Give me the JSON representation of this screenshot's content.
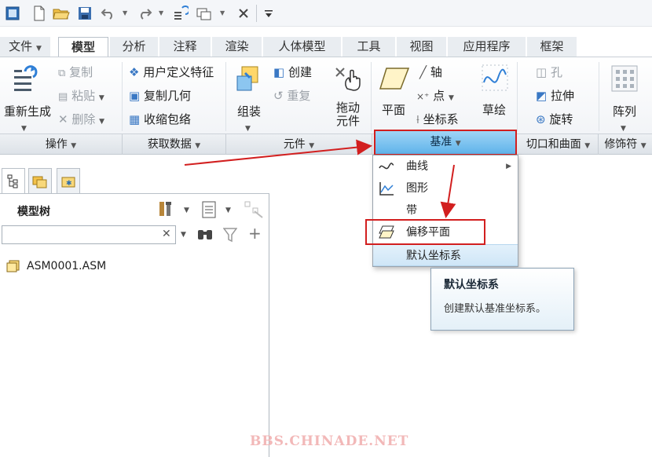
{
  "quick_access": {
    "icons": [
      "window-icon",
      "new-file-icon",
      "open-folder-icon",
      "save-icon",
      "undo-icon",
      "redo-icon",
      "regenerate-icon",
      "windows-icon",
      "close-window-icon",
      "customize-icon"
    ]
  },
  "tabs": [
    {
      "label": "文件",
      "dropdown": true
    },
    {
      "label": "模型",
      "active": true
    },
    {
      "label": "分析"
    },
    {
      "label": "注释"
    },
    {
      "label": "渲染"
    },
    {
      "label": "人体模型"
    },
    {
      "label": "工具"
    },
    {
      "label": "视图"
    },
    {
      "label": "应用程序"
    },
    {
      "label": "框架"
    }
  ],
  "ribbon": {
    "operations": {
      "regenerate": "重新生成",
      "copy": "复制",
      "paste": "粘贴",
      "delete": "删除"
    },
    "get_data": {
      "user_defined_feature": "用户定义特征",
      "copy_geometry": "复制几何",
      "shrinkwrap": "收缩包络"
    },
    "component": {
      "assemble": "组装",
      "create": "创建",
      "repeat": "重复",
      "drag_line1": "拖动",
      "drag_line2": "元件"
    },
    "datum": {
      "plane": "平面",
      "axis": "轴",
      "point": "点",
      "coord_sys": "坐标系",
      "sketch": "草绘"
    },
    "cut_surface": {
      "hole": "孔",
      "extrude": "拉伸",
      "revolve": "旋转"
    },
    "pattern": {
      "pattern": "阵列"
    }
  },
  "groups": [
    {
      "label": "操作"
    },
    {
      "label": "获取数据"
    },
    {
      "label": "元件"
    },
    {
      "label": "基准",
      "active": true
    },
    {
      "label": "切口和曲面"
    },
    {
      "label": "修饰符"
    }
  ],
  "model_tree": {
    "title": "模型树",
    "search_value": "",
    "items": [
      {
        "label": "ASM0001.ASM"
      }
    ]
  },
  "datum_menu": {
    "items": [
      {
        "label": "曲线",
        "icon": "curve-icon",
        "submenu": true
      },
      {
        "label": "图形",
        "icon": "graph-icon"
      },
      {
        "label": "带",
        "icon": ""
      },
      {
        "label": "偏移平面",
        "icon": "offset-plane-icon",
        "highlighted": true
      },
      {
        "label": "默认坐标系",
        "icon": "",
        "hover": true
      }
    ]
  },
  "tooltip": {
    "title": "默认坐标系",
    "description": "创建默认基准坐标系。"
  },
  "watermark": "BBS.CHINADE.NET",
  "colors": {
    "accent_blue": "#5fb3ea",
    "annotation_red": "#d21f1f"
  }
}
